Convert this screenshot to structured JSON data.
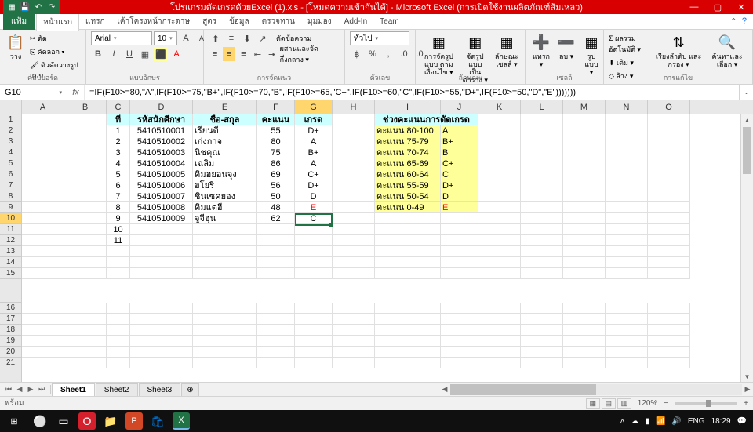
{
  "title": "โปรแกรมตัดเกรดด้วยExcel (1).xls  - [โหมดความเข้ากันได้] - Microsoft Excel (การเปิดใช้งานผลิตภัณฑ์ล้มเหลว)",
  "tabs": {
    "file": "แฟ้ม",
    "items": [
      "หน้าแรก",
      "แทรก",
      "เค้าโครงหน้ากระดาษ",
      "สูตร",
      "ข้อมูล",
      "ตรวจทาน",
      "มุมมอง",
      "Add-In",
      "Team"
    ]
  },
  "ribbon": {
    "clipboard": {
      "label": "คลิปบอร์ด",
      "paste": "วาง",
      "cut": "ตัด",
      "copy": "คัดลอก ▾",
      "painter": "ตัวคัดวางรูปแบบ"
    },
    "font": {
      "label": "แบบอักษร",
      "name": "Arial",
      "size": "10"
    },
    "align": {
      "label": "การจัดแนว",
      "wrap": "ตัดข้อความ",
      "merge": "ผสานและจัดกึ่งกลาง ▾"
    },
    "number": {
      "label": "ตัวเลข",
      "format": "ทั่วไป"
    },
    "styles": {
      "label": "ลักษณะ",
      "cond": "การจัดรูปแบบ\nตามเงื่อนไข ▾",
      "table": "จัดรูปแบบ\nเป็นตาราง ▾",
      "cell": "ลักษณะ\nเซลล์ ▾"
    },
    "cells": {
      "label": "เซลล์",
      "insert": "แทรก\n▾",
      "delete": "ลบ\n▾",
      "format": "รูปแบบ\n▾"
    },
    "editing": {
      "label": "การแก้ไข",
      "autosum": "ผลรวมอัตโนมัติ ▾",
      "fill": "เติม ▾",
      "clear": "ล้าง ▾",
      "sort": "เรียงลำดับ\nและกรอง ▾",
      "find": "ค้นหาและ\nเลือก ▾"
    }
  },
  "namebox": "G10",
  "formula": "=IF(F10>=80,\"A\",IF(F10>=75,\"B+\",IF(F10>=70,\"B\",IF(F10>=65,\"C+\",IF(F10>=60,\"C\",IF(F10>=55,\"D+\",IF(F10>=50,\"D\",\"E\")))))))",
  "cols": [
    "A",
    "B",
    "C",
    "D",
    "E",
    "F",
    "G",
    "H",
    "I",
    "J",
    "K",
    "L",
    "M",
    "N",
    "O"
  ],
  "header_row": {
    "C": "ที่",
    "D": "รหัสนักศึกษา",
    "E": "ชื่อ-สกุล",
    "F": "คะแนน",
    "G": "เกรด",
    "IJ": "ช่วงคะแนนการตัดเกรด"
  },
  "rows": [
    {
      "C": "1",
      "D": "5410510001",
      "E": "เรียนดี",
      "F": "55",
      "G": "D+",
      "I": "คะแนน 80-100",
      "J": "A"
    },
    {
      "C": "2",
      "D": "5410510002",
      "E": "เก่งกาจ",
      "F": "80",
      "G": "A",
      "I": "คะแนน 75-79",
      "J": "B+"
    },
    {
      "C": "3",
      "D": "5410510003",
      "E": "นิชคุณ",
      "F": "75",
      "G": "B+",
      "I": "คะแนน 70-74",
      "J": "B"
    },
    {
      "C": "4",
      "D": "5410510004",
      "E": "เฉลิม",
      "F": "86",
      "G": "A",
      "I": "คะแนน 65-69",
      "J": "C+"
    },
    {
      "C": "5",
      "D": "5410510005",
      "E": "คิมฮยอนจุง",
      "F": "69",
      "G": "C+",
      "I": "คะแนน 60-64",
      "J": "C"
    },
    {
      "C": "6",
      "D": "5410510006",
      "E": "ฮโยรี",
      "F": "56",
      "G": "D+",
      "I": "คะแนน 55-59",
      "J": "D+"
    },
    {
      "C": "7",
      "D": "5410510007",
      "E": "ชินเซคยอง",
      "F": "50",
      "G": "D",
      "I": "คะแนน 50-54",
      "J": "D"
    },
    {
      "C": "8",
      "D": "5410510008",
      "E": "คิมแตฮี",
      "F": "48",
      "G": "E",
      "I": "คะแนน 0-49",
      "J": "E"
    },
    {
      "C": "9",
      "D": "5410510009",
      "E": "จูจีฮุน",
      "F": "62",
      "G": "C",
      "I": "",
      "J": ""
    },
    {
      "C": "10"
    },
    {
      "C": "11"
    }
  ],
  "sheets": [
    "Sheet1",
    "Sheet2",
    "Sheet3"
  ],
  "status": "พร้อม",
  "zoom": "120%",
  "taskbar": {
    "lang": "ENG",
    "time": "18:29"
  }
}
